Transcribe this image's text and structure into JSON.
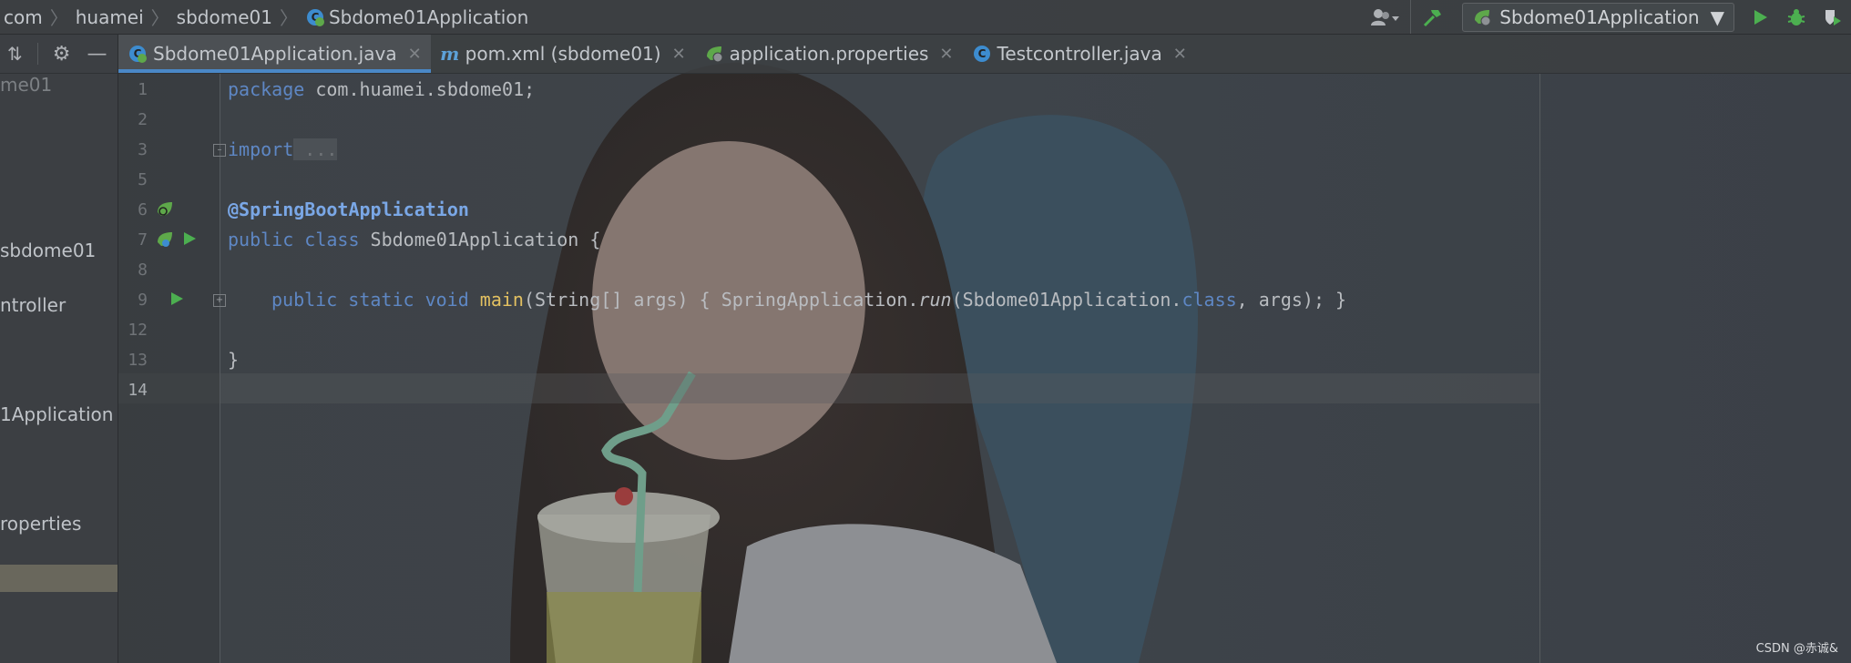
{
  "breadcrumbs": [
    "com",
    "huamei",
    "sbdome01",
    "Sbdome01Application"
  ],
  "run_config": {
    "label": "Sbdome01Application"
  },
  "tabs": [
    {
      "label": "Sbdome01Application.java",
      "icon": "spring-class-icon"
    },
    {
      "label": "pom.xml (sbdome01)",
      "icon": "maven-icon"
    },
    {
      "label": "application.properties",
      "icon": "spring-properties-icon"
    },
    {
      "label": "Testcontroller.java",
      "icon": "class-icon"
    }
  ],
  "project_tree": [
    "me01",
    "sbdome01",
    "ntroller",
    "1Application",
    "roperties"
  ],
  "editor": {
    "line_numbers": [
      "1",
      "2",
      "3",
      "5",
      "6",
      "7",
      "8",
      "9",
      "12",
      "13",
      "14"
    ],
    "code": {
      "l1_kw": "package",
      "l1_rest": " com.huamei.sbdome01;",
      "l3_kw": "import",
      "l3_rest": " ...",
      "l6": "@SpringBootApplication",
      "l7_kw": "public class",
      "l7_rest": " Sbdome01Application {",
      "l9_kw": "public static void",
      "l9_fn": "main",
      "l9_a": "(String[] args) { SpringApplication.",
      "l9_run": "run",
      "l9_b": "(Sbdome01Application.",
      "l9_class": "class",
      "l9_c": ", args); }",
      "l13": "}"
    }
  },
  "watermark": "CSDN @赤诚&",
  "colors": {
    "accent": "#4a88c7",
    "keyword": "#5e87c4",
    "annotation": "#7aa7e6",
    "function": "#e2c061",
    "run_green": "#4caf50"
  }
}
